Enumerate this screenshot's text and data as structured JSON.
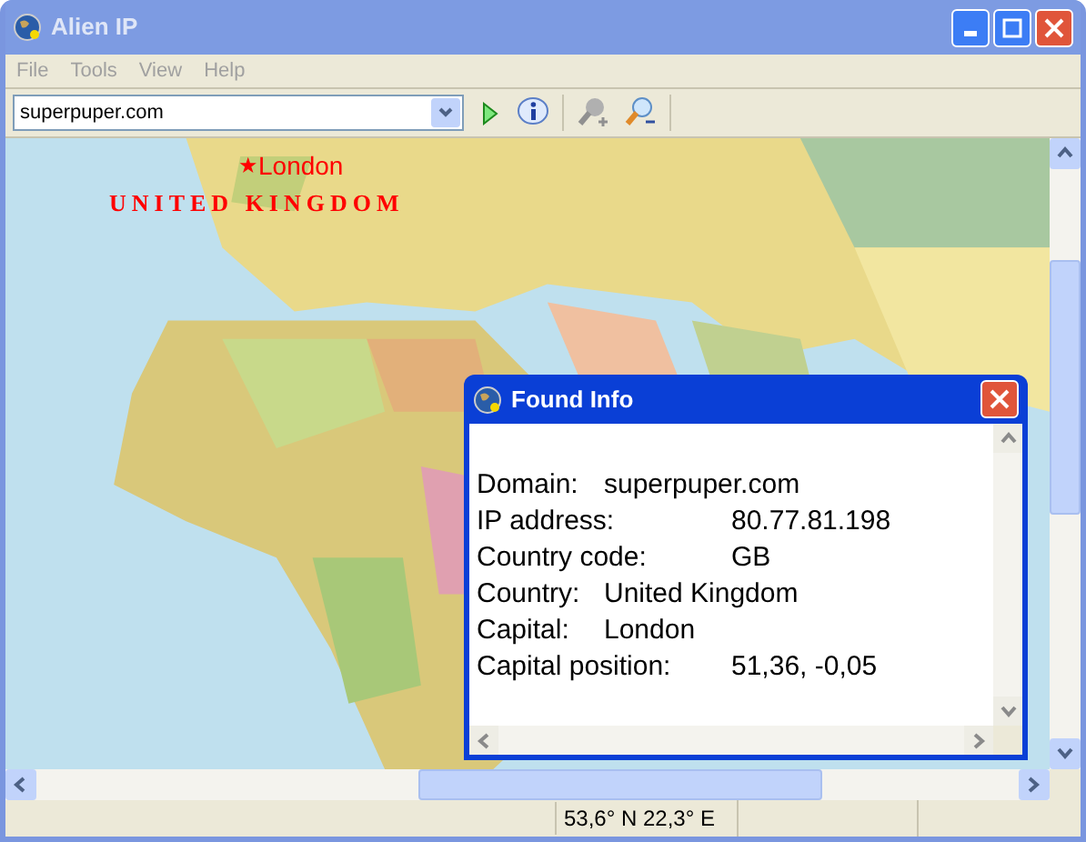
{
  "window": {
    "title": "Alien IP"
  },
  "menu": [
    "File",
    "Tools",
    "View",
    "Help"
  ],
  "toolbar": {
    "address": {
      "value": "superpuper.com"
    }
  },
  "map": {
    "markers": [
      {
        "kind": "city",
        "symbol": "★",
        "label": "London"
      },
      {
        "kind": "country",
        "label": "UNITED KINGDOM"
      }
    ]
  },
  "dialog": {
    "title": "Found Info",
    "lines": [
      "Domain:\tsuperpuper.com",
      "IP address:\t80.77.81.198",
      "Country code:\tGB",
      "Country:\tUnited Kingdom",
      "Capital:\tLondon",
      "Capital position:\t51,36, -0,05"
    ]
  },
  "status_bar": {
    "coordinates": "53,6° N 22,3° E"
  }
}
